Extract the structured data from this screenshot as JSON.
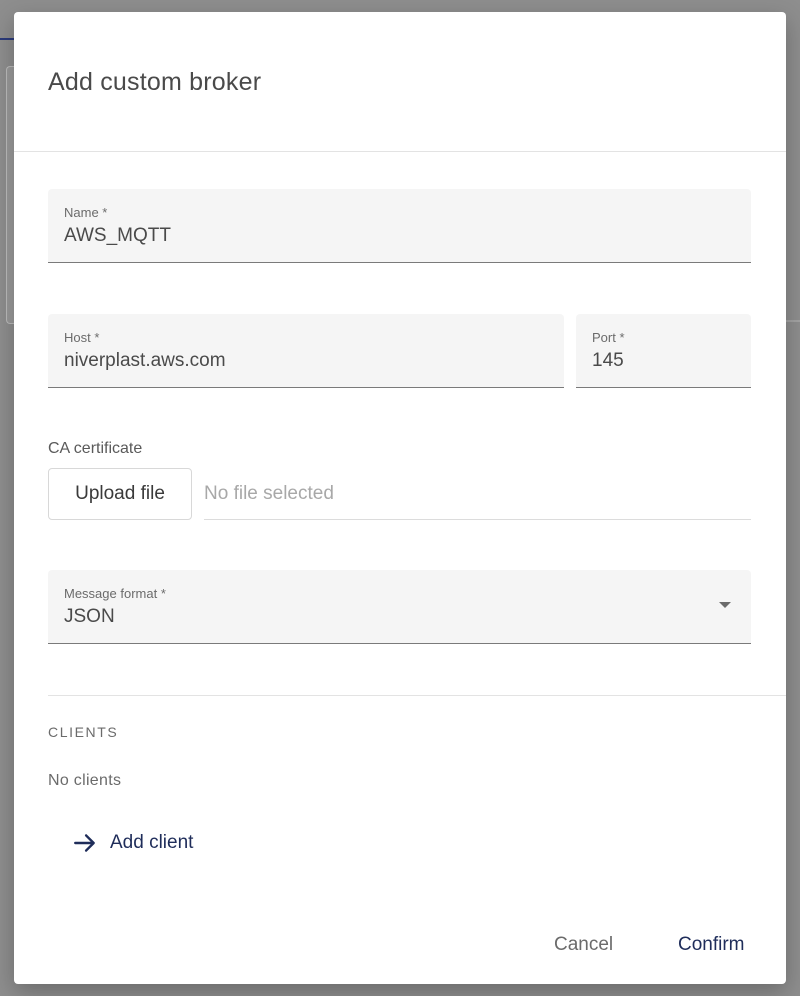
{
  "dialog": {
    "title": "Add custom broker"
  },
  "fields": {
    "name": {
      "label": "Name *",
      "value": "AWS_MQTT"
    },
    "host": {
      "label": "Host *",
      "value": "niverplast.aws.com"
    },
    "port": {
      "label": "Port *",
      "value": "145"
    },
    "ca_certificate": {
      "label": "CA certificate",
      "upload_label": "Upload file",
      "status": "No file selected"
    },
    "message_format": {
      "label": "Message format *",
      "value": "JSON"
    }
  },
  "clients": {
    "heading": "CLIENTS",
    "empty_text": "No clients",
    "add_label": "Add client",
    "add_icon": "arrow-right-icon"
  },
  "actions": {
    "cancel_label": "Cancel",
    "confirm_label": "Confirm"
  },
  "colors": {
    "accent": "#1f2d5a",
    "field_bg": "#f5f5f5",
    "backdrop": "#8e8e8e"
  }
}
